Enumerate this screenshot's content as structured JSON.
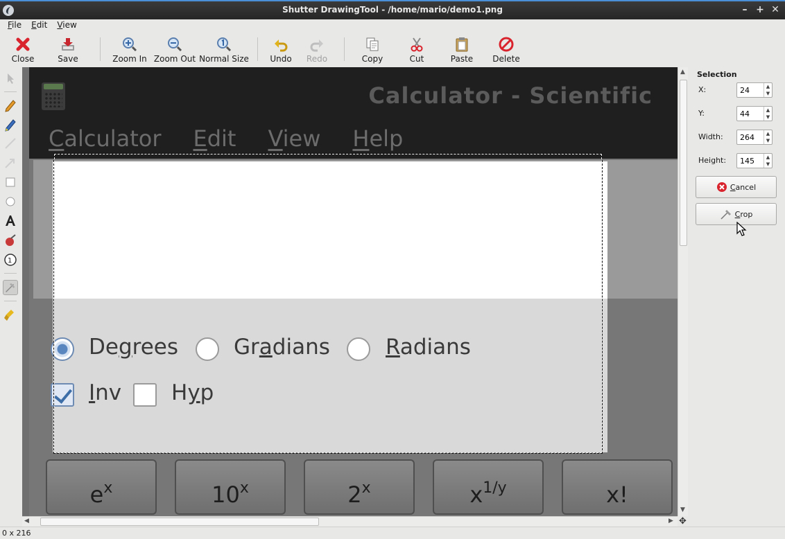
{
  "window": {
    "title": "Shutter DrawingTool - /home/mario/demo1.png",
    "controls": [
      "–",
      "+",
      "✕"
    ]
  },
  "menubar": [
    {
      "label": "File",
      "mnemonic": "F",
      "rest": "ile"
    },
    {
      "label": "Edit",
      "mnemonic": "E",
      "rest": "dit"
    },
    {
      "label": "View",
      "mnemonic": "V",
      "rest": "iew"
    }
  ],
  "toolbar": {
    "close": "Close",
    "save": "Save",
    "zoom_in": "Zoom In",
    "zoom_out": "Zoom Out",
    "normal_size": "Normal Size",
    "undo": "Undo",
    "redo": "Redo",
    "copy": "Copy",
    "cut": "Cut",
    "paste": "Paste",
    "delete": "Delete"
  },
  "canvas": {
    "calc_title": "Calculator - Scientific",
    "calc_menus": [
      {
        "first": "C",
        "rest": "alculator"
      },
      {
        "first": "E",
        "rest": "dit"
      },
      {
        "first": "V",
        "rest": "iew"
      },
      {
        "first": "H",
        "rest": "elp"
      }
    ],
    "angle_options": [
      {
        "pre": "De",
        "mn": "g",
        "post": "rees",
        "checked": true
      },
      {
        "pre": "Gr",
        "mn": "a",
        "post": "dians",
        "checked": false
      },
      {
        "pre": "",
        "mn": "R",
        "post": "adians",
        "checked": false
      }
    ],
    "mode_options": [
      {
        "pre": "",
        "mn": "I",
        "post": "nv",
        "checked": true
      },
      {
        "pre": "H",
        "mn": "y",
        "post": "p",
        "checked": false
      }
    ],
    "keys": [
      {
        "base": "e",
        "sup": "x"
      },
      {
        "base": "10",
        "sup": "x"
      },
      {
        "base": "2",
        "sup": "x"
      },
      {
        "base": "x",
        "sup": "1/y"
      },
      {
        "base": "x!",
        "sup": ""
      }
    ]
  },
  "panel": {
    "heading": "Selection",
    "x_label": "X:",
    "x_value": "24",
    "y_label": "Y:",
    "y_value": "44",
    "width_label": "Width:",
    "width_value": "264",
    "height_label": "Height:",
    "height_value": "145",
    "cancel_label_mn": "C",
    "cancel_label_rest": "ancel",
    "crop_label_mn": "C",
    "crop_label_rest": "rop"
  },
  "statusbar": {
    "text": "0 x 216"
  },
  "colors": {
    "accent": "#4a90d9",
    "close_red": "#d9232d",
    "save_red": "#c8262e",
    "undo_yellow": "#e0b31c",
    "selection_dash": "#111111"
  }
}
